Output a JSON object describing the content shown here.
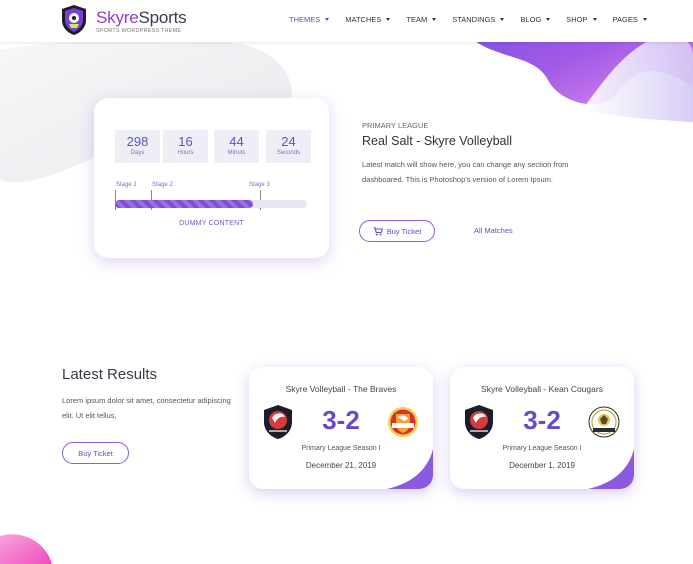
{
  "header": {
    "brand_part1": "Skyre",
    "brand_part2": "Sports",
    "tagline": "SPORTS WORDPRESS THEME",
    "nav": [
      {
        "label": "THEMES",
        "active": true
      },
      {
        "label": "MATCHES",
        "active": false
      },
      {
        "label": "TEAM",
        "active": false
      },
      {
        "label": "STANDINGS",
        "active": false
      },
      {
        "label": "BLOG",
        "active": false
      },
      {
        "label": "SHOP",
        "active": false
      },
      {
        "label": "PAGES",
        "active": false
      }
    ]
  },
  "countdown": {
    "units": [
      {
        "value": "298",
        "label": "Days"
      },
      {
        "value": "16",
        "label": "Hours"
      },
      {
        "value": "44",
        "label": "Minuts"
      },
      {
        "value": "24",
        "label": "Seconds"
      }
    ],
    "stages": [
      "Stage 1",
      "Stage 2",
      "Stage 3"
    ],
    "progress_percent": 72,
    "caption": "DUMMY CONTENT"
  },
  "match": {
    "league": "PRIMARY LEAGUE",
    "title": "Real Salt - Skyre Volleyball",
    "description": "Latest match will show here, you can change any section from dashboared. This is Photoshop's version of Lorem Ipsum.",
    "buy_label": "Buy Ticket",
    "all_matches_label": "All Matches"
  },
  "results": {
    "title": "Latest Results",
    "description": "Lorem ipsum dolor sit amet, consectetur adipiscing elit. Ut elit tellus,",
    "buy_label": "Buy Ticket",
    "cards": [
      {
        "title": "Skyre Volleyball - The Braves",
        "score": "3-2",
        "season": "Primary League Season I",
        "date": "December 21, 2019"
      },
      {
        "title": "Skyre Volleyball - Kean Cougars",
        "score": "3-2",
        "season": "Primary League Season I",
        "date": "December 1, 2019"
      }
    ]
  },
  "colors": {
    "accent": "#7b3ad6",
    "blob_pink": "#f05fc8",
    "blob_violet": "#8a4fe0"
  }
}
